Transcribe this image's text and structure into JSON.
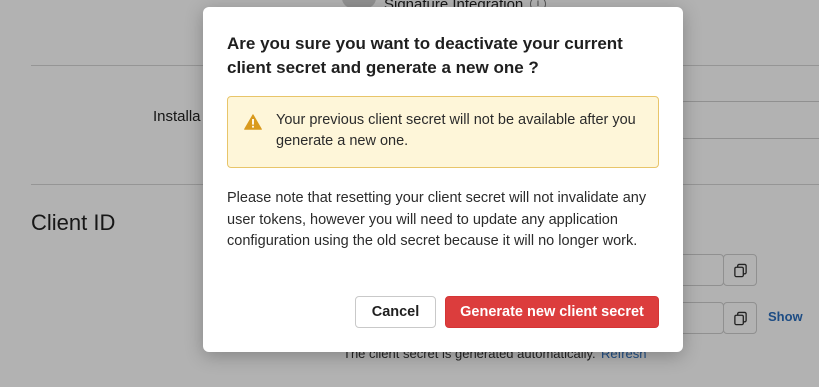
{
  "background": {
    "signature_label": "Signature Integration",
    "installation_label": "Installa",
    "client_id_title": "Client ID",
    "show_link": "Show",
    "auto_note": "The client secret is generated automatically.",
    "refresh_link": "Refresh"
  },
  "modal": {
    "title": "Are you sure you want to deactivate your current client secret and generate a new one ?",
    "warning_text": "Your previous client secret will not be available after you generate a new one.",
    "note": "Please note that resetting your client secret will not invalidate any user tokens, however you will need to update any application configuration using the old secret because it will no longer work.",
    "cancel_label": "Cancel",
    "generate_label": "Generate new client secret"
  },
  "colors": {
    "danger": "#dc3d3d",
    "warning_bg": "#fef6d9",
    "warning_border": "#e8c56a",
    "warning_icon": "#d99a1e",
    "link": "#2a6ebd"
  },
  "icons": [
    "info-icon",
    "copy-icon",
    "warning-icon"
  ]
}
